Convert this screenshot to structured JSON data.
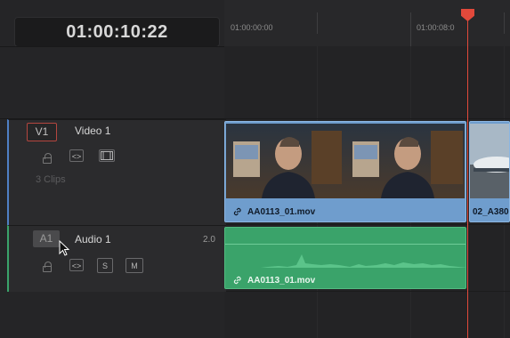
{
  "timecode": "01:00:10:22",
  "ruler": {
    "labels": [
      "01:00:00:00",
      "01:00:08:0"
    ]
  },
  "video_track": {
    "id": "V1",
    "name": "Video 1",
    "clip_count": "3 Clips",
    "clip1_name": "AA0113_01.mov",
    "clip2_name": "02_A380"
  },
  "audio_track": {
    "id": "A1",
    "name": "Audio 1",
    "channel": "2.0",
    "solo_label": "S",
    "mute_label": "M",
    "clip_name": "AA0113_01.mov"
  },
  "colors": {
    "video_clip": "#6f9dcd",
    "audio_clip": "#3aa36a",
    "playhead": "#e2493b",
    "video_track_indicator": "#4f7fc4",
    "audio_track_indicator": "#3aa36a"
  },
  "icons": [
    "lock-icon",
    "link-icon",
    "film-icon",
    "auto-select-icon",
    "solo-button",
    "mute-button",
    "pointer-cursor"
  ]
}
